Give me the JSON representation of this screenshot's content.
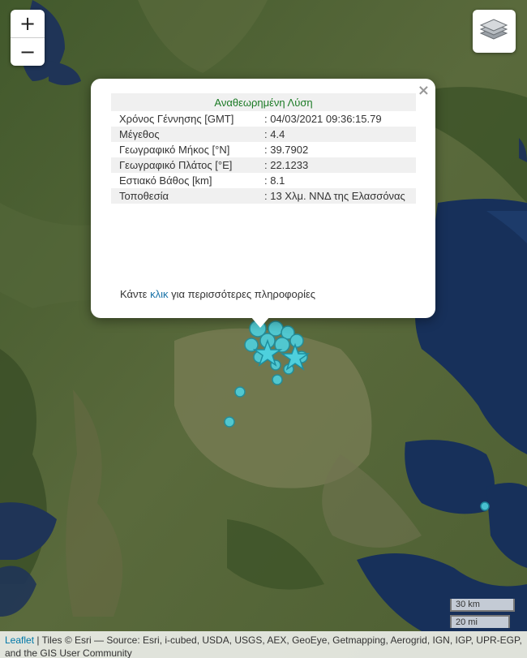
{
  "zoom": {
    "in_label": "+",
    "out_label": "−"
  },
  "popup": {
    "title": "Αναθεωρημένη Λύση",
    "close_label": "×",
    "rows": [
      {
        "label": "Χρόνος Γέννησης [GMT]",
        "value": ": 04/03/2021 09:36:15.79"
      },
      {
        "label": "Μέγεθος",
        "value": ": 4.4"
      },
      {
        "label": "Γεωγραφικό Μήκος [°N]",
        "value": ": 39.7902"
      },
      {
        "label": "Γεωγραφικό Πλάτος [°E]",
        "value": ": 22.1233"
      },
      {
        "label": "Εστιακό Βάθος [km]",
        "value": ": 8.1"
      },
      {
        "label": "Τοποθεσία",
        "value": ": 13 Χλμ. ΝΝΔ της Ελασσόνας"
      }
    ],
    "more_prefix": "Κάντε ",
    "more_link": "κλικ",
    "more_suffix": " για περισσότερες πληροφορίες"
  },
  "scale": {
    "km": "30 km",
    "mi": "20 mi"
  },
  "attribution": {
    "leaflet": "Leaflet",
    "text": " | Tiles © Esri — Source: Esri, i-cubed, USDA, USGS, AEX, GeoEye, Getmapping, Aerogrid, IGN, IGP, UPR-EGP, and the GIS User Community"
  },
  "colors": {
    "marker": "#4ed0dd",
    "marker_stroke": "#1d8fa0",
    "sea": "#17305a",
    "land": "#4a6234"
  },
  "icons": {
    "layers": "layers-icon",
    "star": "star-marker-icon"
  }
}
